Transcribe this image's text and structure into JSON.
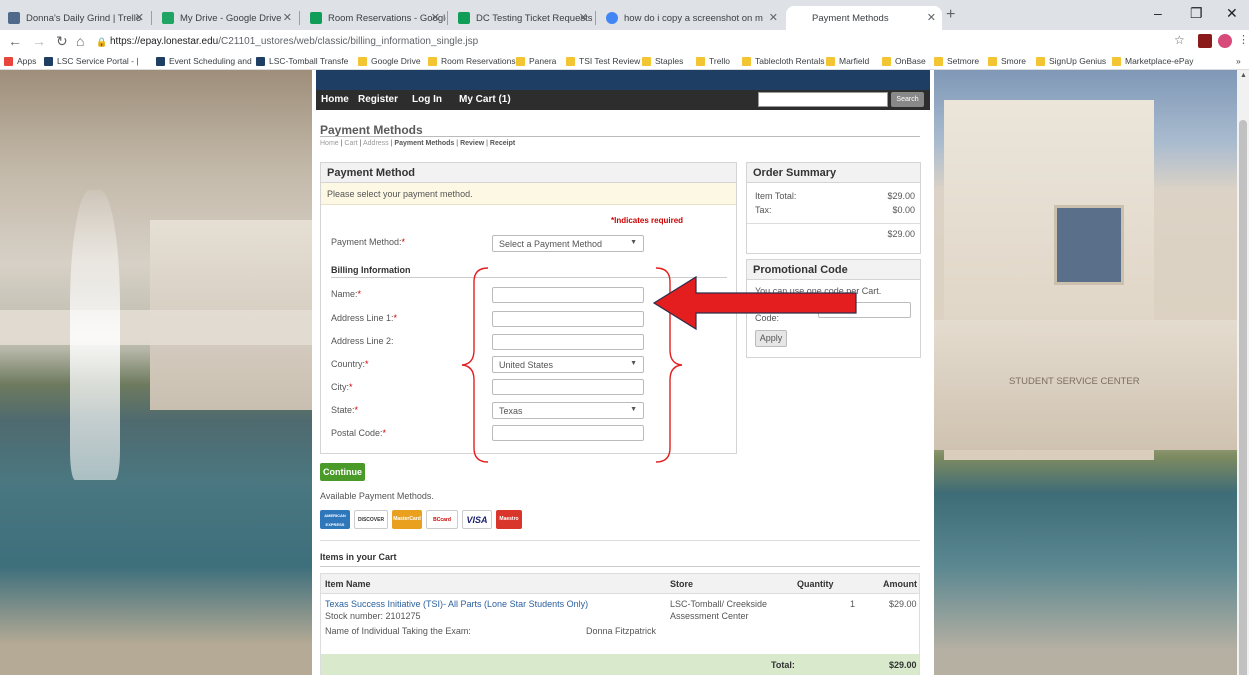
{
  "browser": {
    "tabs": [
      {
        "title": "Donna's Daily Grind | Trello",
        "color": "#4f6a8a"
      },
      {
        "title": "My Drive - Google Drive",
        "color": "#1fa463"
      },
      {
        "title": "Room Reservations - Google She",
        "color": "#0f9d58"
      },
      {
        "title": "DC Testing Ticket Requests (Tab",
        "color": "#0f9d58"
      },
      {
        "title": "how do i copy a screenshot on m",
        "color": "#4285f4"
      },
      {
        "title": "Payment Methods",
        "color": "#ffffff"
      }
    ],
    "url_host": "https://epay.lonestar.edu",
    "url_path": "/C21101_ustores/web/classic/billing_information_single.jsp",
    "bookmarks": [
      {
        "label": "Apps",
        "color": "#e8453c"
      },
      {
        "label": "LSC Service Portal - |",
        "color": "#1f3e63"
      },
      {
        "label": "Event Scheduling and",
        "color": "#1f3e63"
      },
      {
        "label": "LSC-Tomball Transfe",
        "color": "#1f3e63"
      },
      {
        "label": "Google Drive",
        "color": "#f3c532"
      },
      {
        "label": "Room Reservations",
        "color": "#f3c532"
      },
      {
        "label": "Panera",
        "color": "#f3c532"
      },
      {
        "label": "TSI Test Review",
        "color": "#f3c532"
      },
      {
        "label": "Staples",
        "color": "#f3c532"
      },
      {
        "label": "Trello",
        "color": "#f3c532"
      },
      {
        "label": "Tablecloth Rentals",
        "color": "#f3c532"
      },
      {
        "label": "Marfield",
        "color": "#f3c532"
      },
      {
        "label": "OnBase",
        "color": "#f3c532"
      },
      {
        "label": "Setmore",
        "color": "#f3c532"
      },
      {
        "label": "Smore",
        "color": "#f3c532"
      },
      {
        "label": "SignUp Genius",
        "color": "#f3c532"
      },
      {
        "label": "Marketplace-ePay",
        "color": "#f3c532"
      }
    ],
    "bookmarks_more": "»"
  },
  "site": {
    "nav": {
      "home": "Home",
      "register": "Register",
      "login": "Log In",
      "cart": "My Cart (1)",
      "search_button": "Search"
    },
    "heading": "Payment Methods",
    "breadcrumb": {
      "home": "Home",
      "cart": "Cart",
      "address": "Address",
      "payment": "Payment Methods",
      "review": "Review",
      "receipt": "Receipt",
      "sep": "|"
    }
  },
  "payment": {
    "title": "Payment Method",
    "note": "Please select your payment method.",
    "required_note": "*Indicates required",
    "method_label": "Payment Method:",
    "method_value": "Select a Payment Method",
    "billing_title": "Billing Information",
    "fields": {
      "name": "Name:",
      "address1": "Address Line 1:",
      "address2": "Address Line 2:",
      "country": "Country:",
      "city": "City:",
      "state": "State:",
      "postal": "Postal Code:"
    },
    "star": "*",
    "country_value": "United States",
    "state_value": "Texas",
    "continue_label": "Continue",
    "available_text": "Available Payment Methods.",
    "cards": [
      "AMERICAN EXPRESS",
      "DISCOVER",
      "MasterCard",
      "BCcard",
      "VISA",
      "Maestro"
    ]
  },
  "order_summary": {
    "title": "Order Summary",
    "item_total_label": "Item Total:",
    "item_total": "$29.00",
    "tax_label": "Tax:",
    "tax": "$0.00",
    "total": "$29.00"
  },
  "promo": {
    "title": "Promotional Code",
    "text": "You can use one code per Cart.",
    "label": "Promotional Code:",
    "apply": "Apply"
  },
  "cart": {
    "heading": "Items in your Cart",
    "columns": {
      "item": "Item Name",
      "store": "Store",
      "quantity": "Quantity",
      "amount": "Amount"
    },
    "item_name": "Texas Success Initiative (TSI)- All Parts (Lone Star Students Only)",
    "stock": "Stock number: 2101275",
    "store_line1": "LSC-Tomball/ Creekside",
    "store_line2": "Assessment Center",
    "quantity": "1",
    "amount": "$29.00",
    "exam_label": "Name of Individual Taking the Exam:",
    "exam_value": "Donna Fitzpatrick",
    "total_label": "Total:",
    "total": "$29.00"
  },
  "background": {
    "building_sign": "STUDENT SERVICE CENTER"
  },
  "colors": {
    "annotation_red": "#e41e1e",
    "nav_bg": "#2d2d2d",
    "banner": "#1f3e63",
    "continue_green": "#4a9a2a"
  }
}
